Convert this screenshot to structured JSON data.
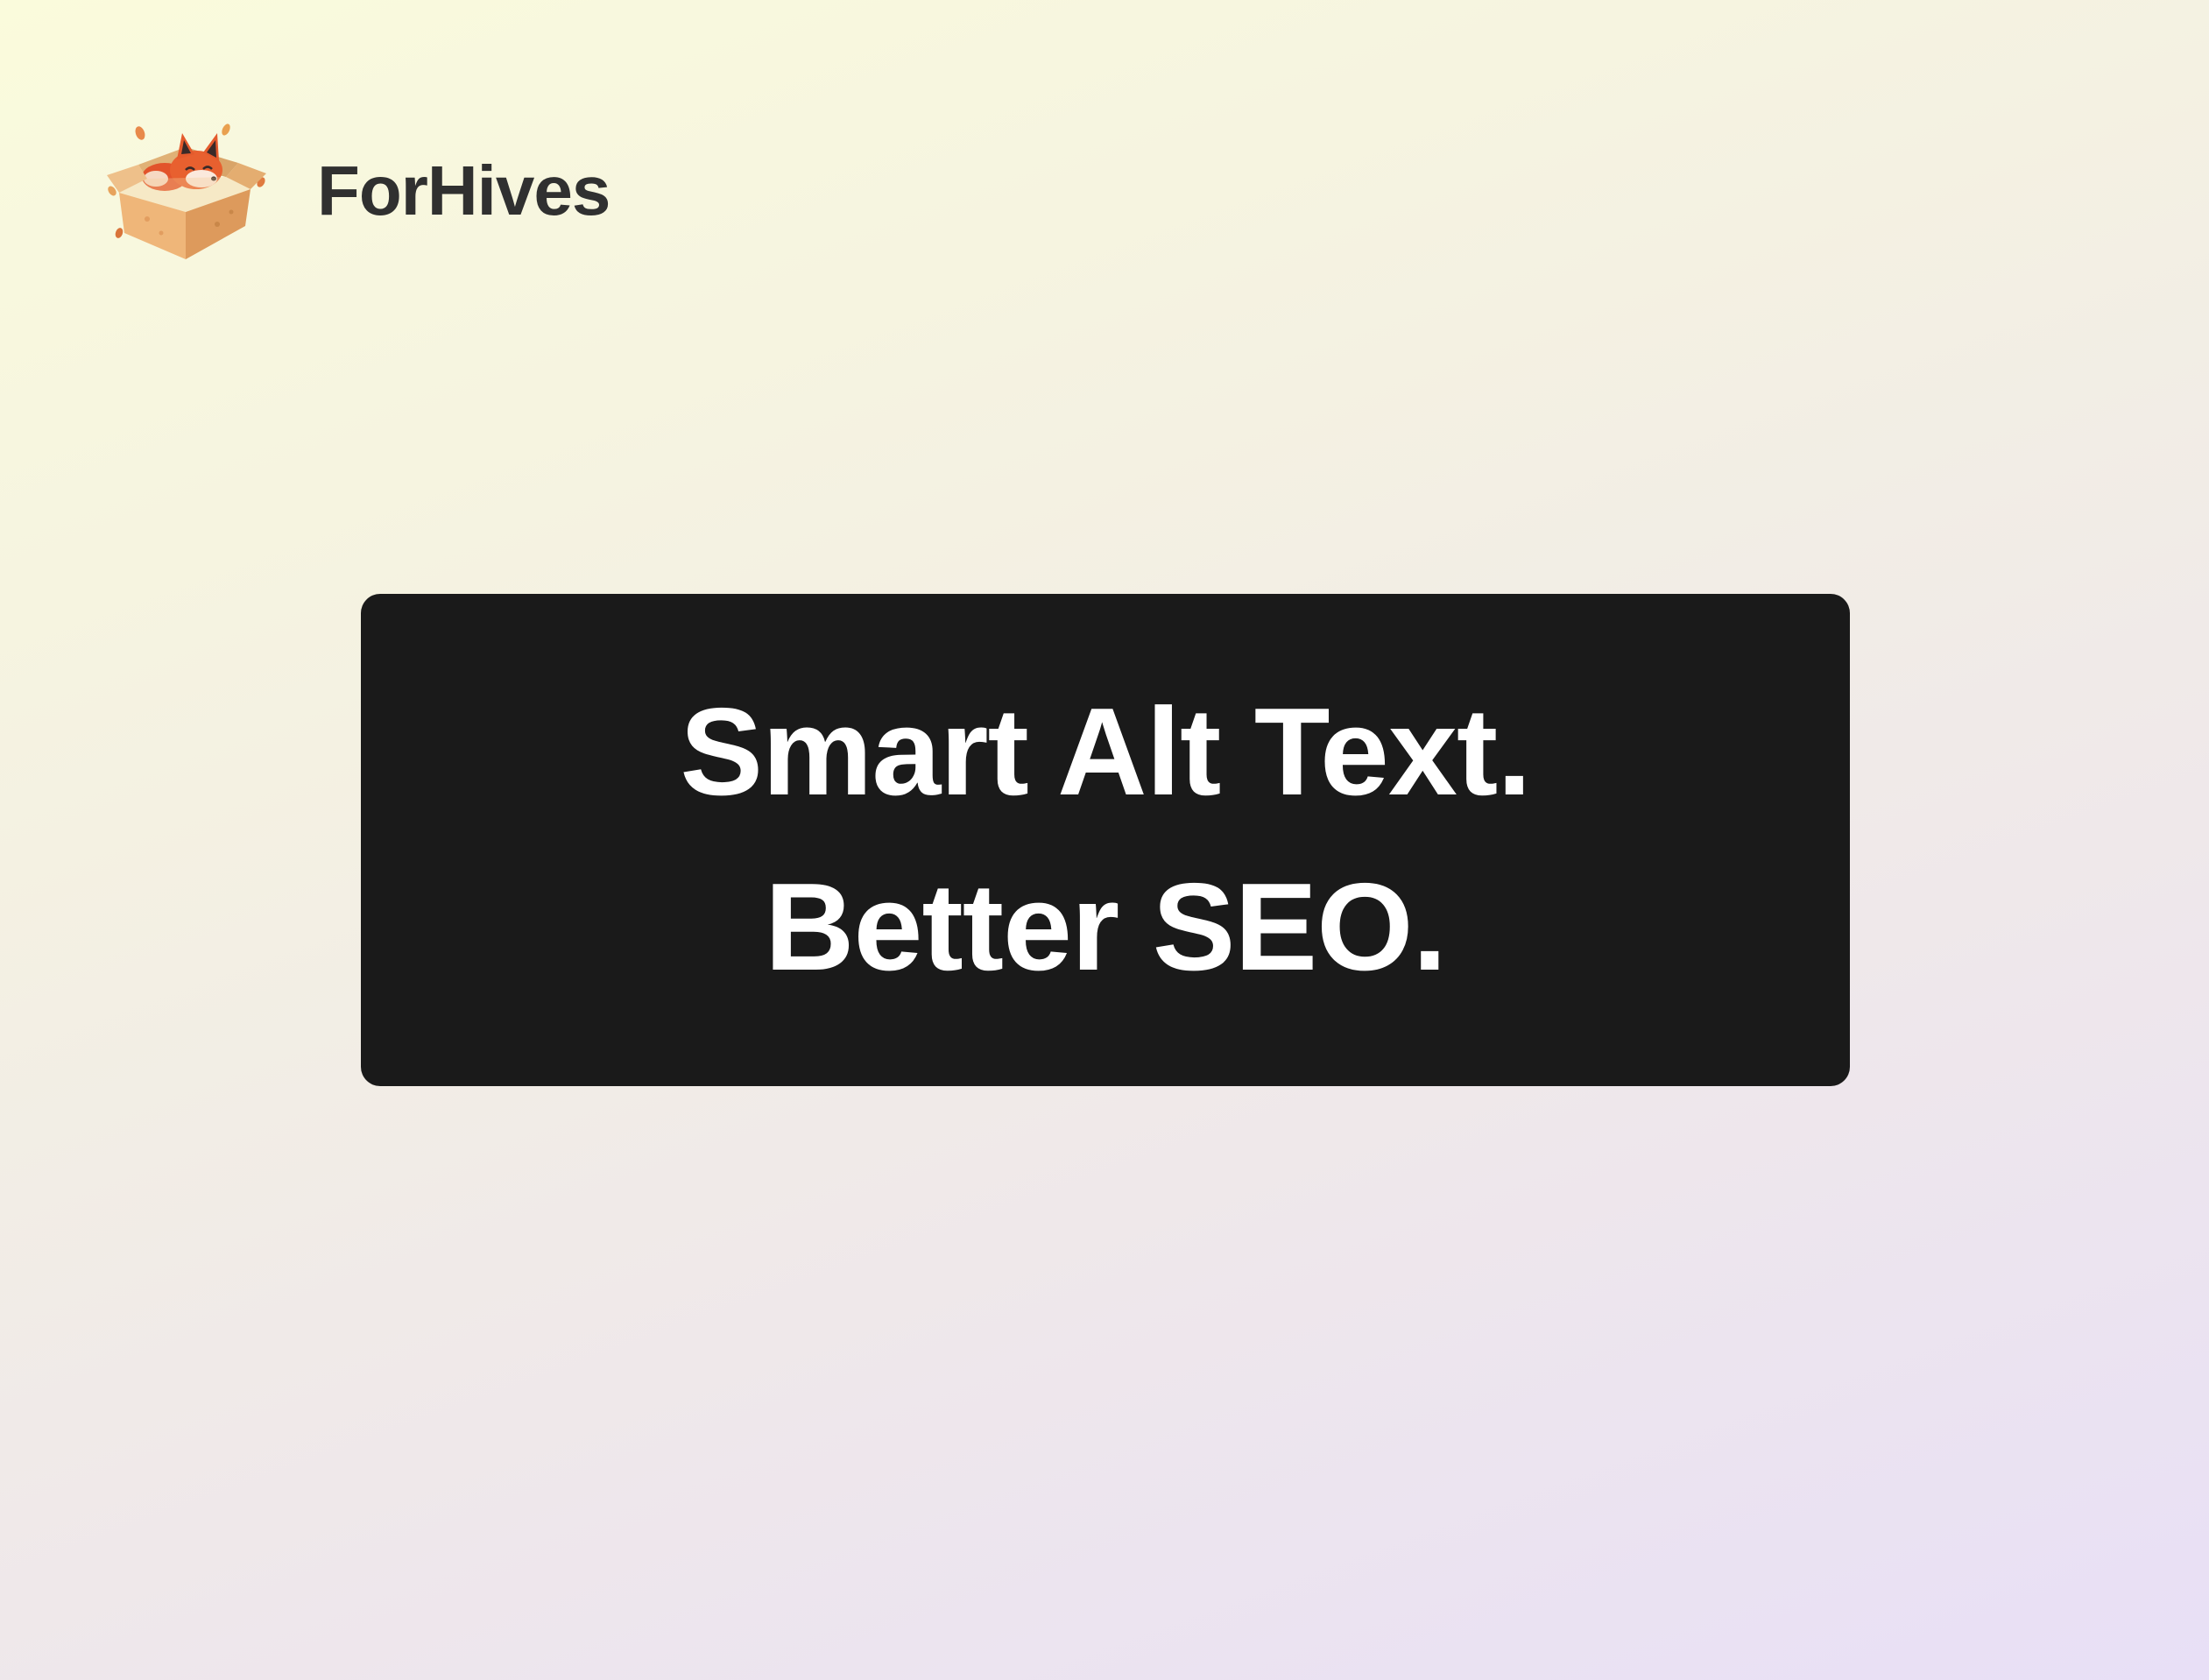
{
  "brand": {
    "name": "ForHives",
    "logo_icon": "fox-in-box-icon"
  },
  "hero": {
    "line1": "Smart Alt Text.",
    "line2": "Better SEO."
  },
  "colors": {
    "card_background": "#1a1a1a",
    "headline_text": "#ffffff",
    "brand_text": "#303030",
    "gradient_top": "#fafbdc",
    "gradient_bottom": "#e8dff6"
  }
}
